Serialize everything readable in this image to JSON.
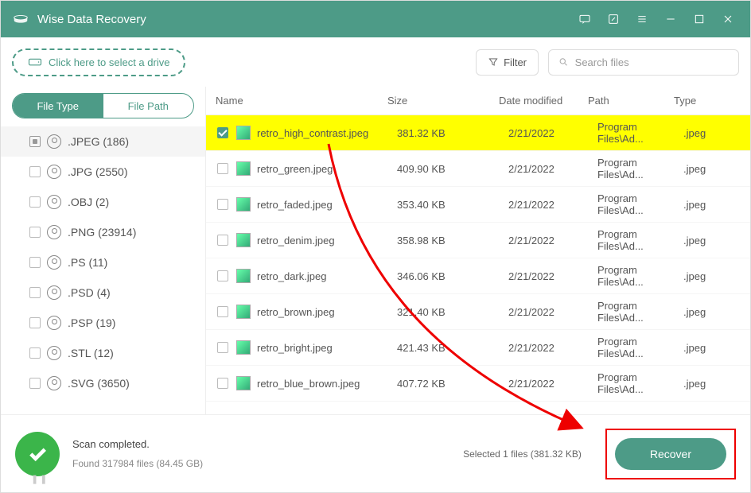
{
  "app": {
    "title": "Wise Data Recovery"
  },
  "toolbar": {
    "drive_select_label": "Click here to select a drive",
    "filter_label": "Filter",
    "search_placeholder": "Search files"
  },
  "sidebar": {
    "tabs": {
      "file_type": "File Type",
      "file_path": "File Path"
    },
    "types": [
      {
        "label": ".JPEG (186)",
        "selected": true
      },
      {
        "label": ".JPG (2550)",
        "selected": false
      },
      {
        "label": ".OBJ (2)",
        "selected": false
      },
      {
        "label": ".PNG (23914)",
        "selected": false
      },
      {
        "label": ".PS (11)",
        "selected": false
      },
      {
        "label": ".PSD (4)",
        "selected": false
      },
      {
        "label": ".PSP (19)",
        "selected": false
      },
      {
        "label": ".STL (12)",
        "selected": false
      },
      {
        "label": ".SVG (3650)",
        "selected": false
      }
    ]
  },
  "table": {
    "headers": {
      "name": "Name",
      "size": "Size",
      "date": "Date modified",
      "path": "Path",
      "type": "Type"
    },
    "rows": [
      {
        "name": "retro_high_contrast.jpeg",
        "size": "381.32 KB",
        "date": "2/21/2022",
        "path": "Program Files\\Ad...",
        "type": ".jpeg",
        "checked": true
      },
      {
        "name": "retro_green.jpeg",
        "size": "409.90 KB",
        "date": "2/21/2022",
        "path": "Program Files\\Ad...",
        "type": ".jpeg",
        "checked": false
      },
      {
        "name": "retro_faded.jpeg",
        "size": "353.40 KB",
        "date": "2/21/2022",
        "path": "Program Files\\Ad...",
        "type": ".jpeg",
        "checked": false
      },
      {
        "name": "retro_denim.jpeg",
        "size": "358.98 KB",
        "date": "2/21/2022",
        "path": "Program Files\\Ad...",
        "type": ".jpeg",
        "checked": false
      },
      {
        "name": "retro_dark.jpeg",
        "size": "346.06 KB",
        "date": "2/21/2022",
        "path": "Program Files\\Ad...",
        "type": ".jpeg",
        "checked": false
      },
      {
        "name": "retro_brown.jpeg",
        "size": "321.40 KB",
        "date": "2/21/2022",
        "path": "Program Files\\Ad...",
        "type": ".jpeg",
        "checked": false
      },
      {
        "name": "retro_bright.jpeg",
        "size": "421.43 KB",
        "date": "2/21/2022",
        "path": "Program Files\\Ad...",
        "type": ".jpeg",
        "checked": false
      },
      {
        "name": "retro_blue_brown.jpeg",
        "size": "407.72 KB",
        "date": "2/21/2022",
        "path": "Program Files\\Ad...",
        "type": ".jpeg",
        "checked": false
      }
    ]
  },
  "footer": {
    "scan_status": "Scan completed.",
    "scan_summary": "Found 317984 files (84.45 GB)",
    "selection_info": "Selected 1 files (381.32 KB)",
    "recover_label": "Recover"
  }
}
